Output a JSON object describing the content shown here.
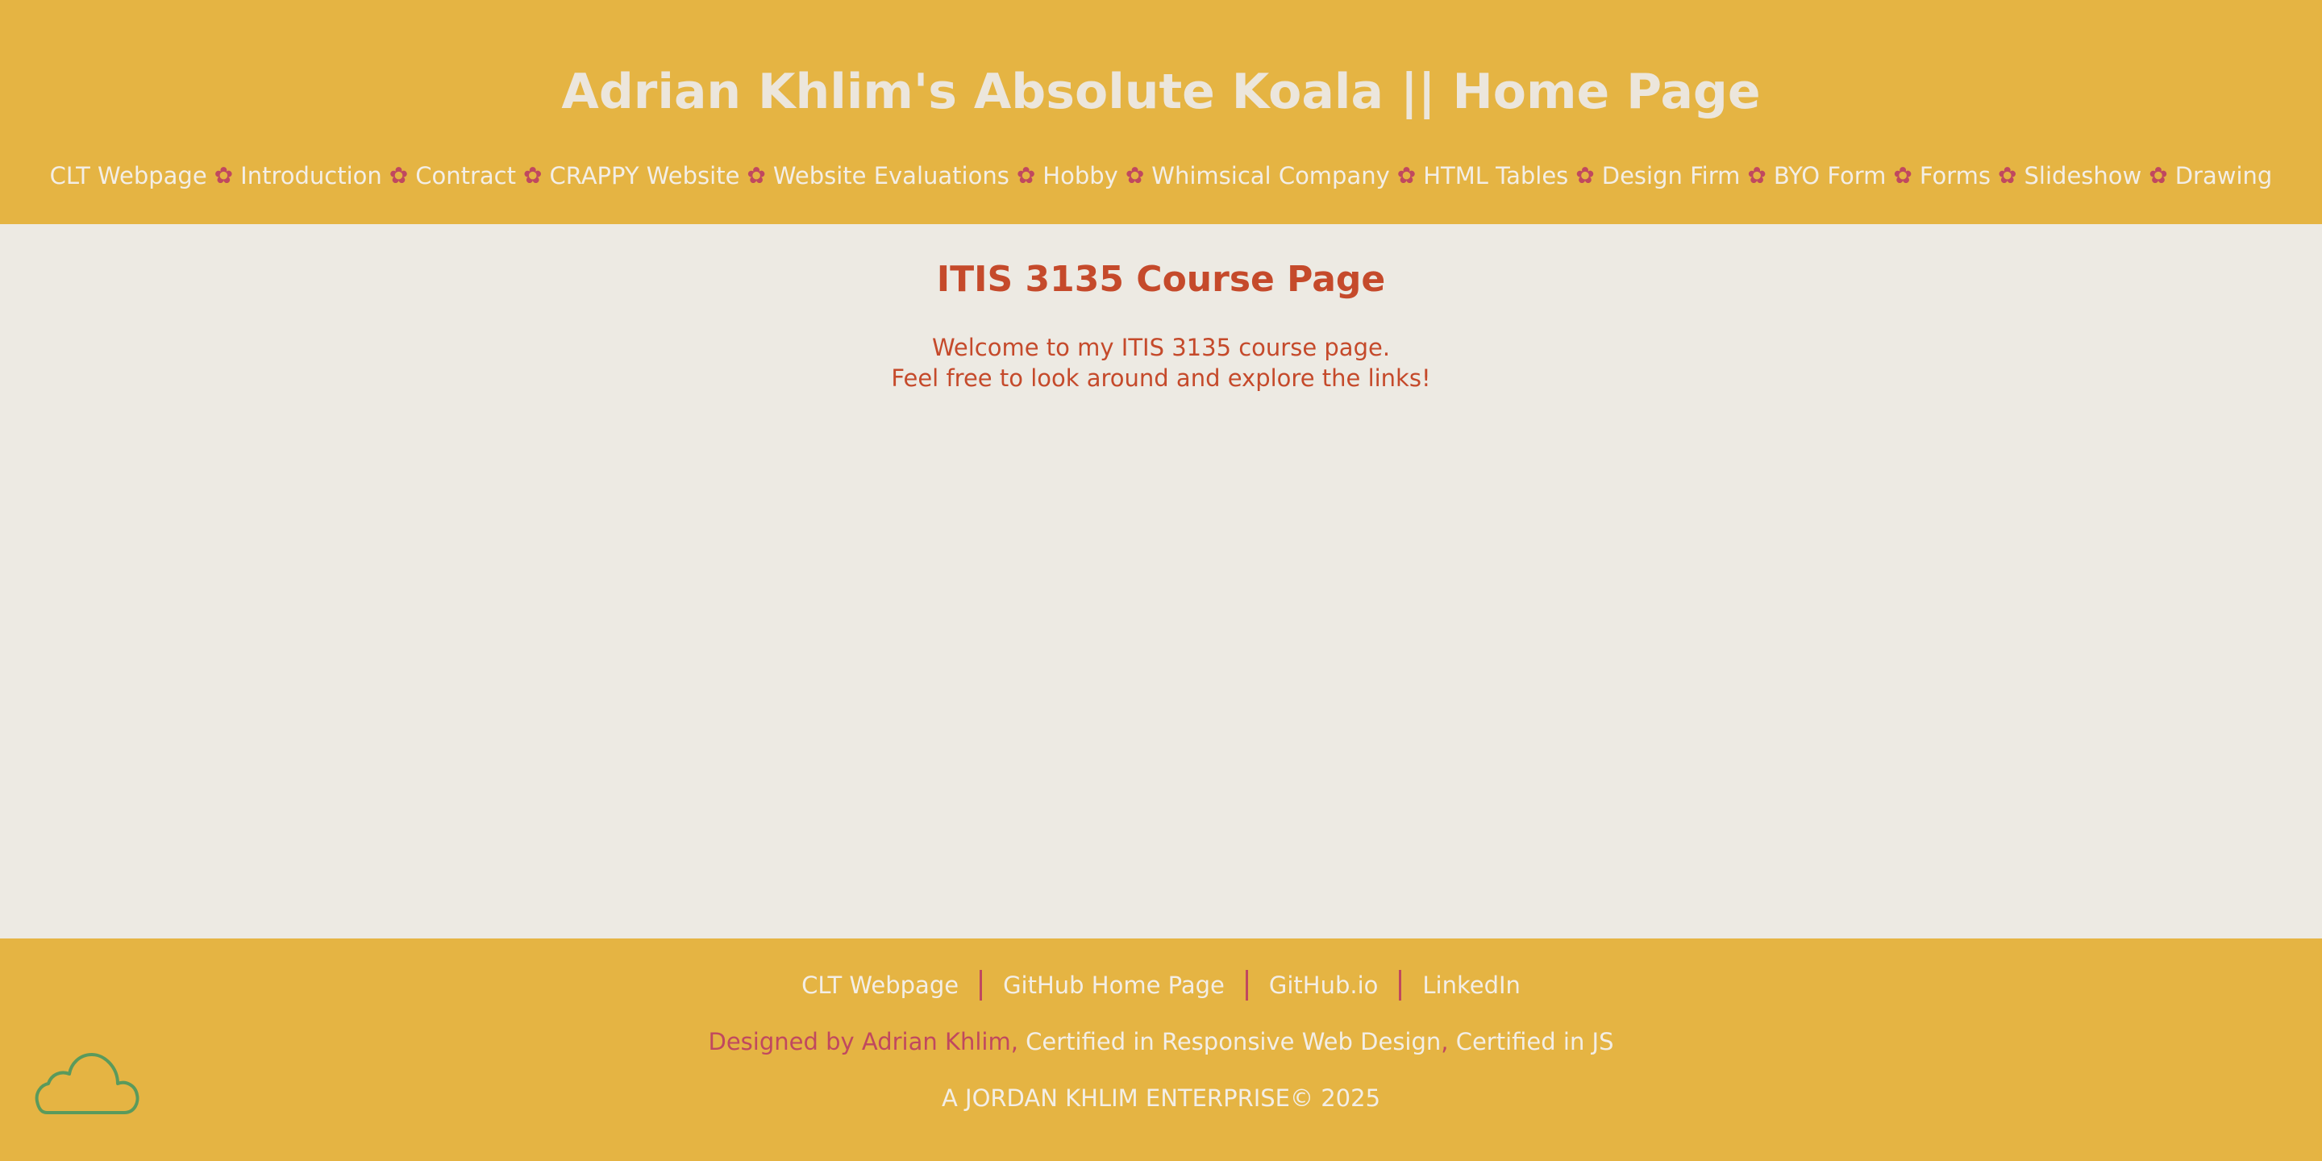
{
  "header": {
    "title": "Adrian Khlim's Absolute Koala || Home Page",
    "nav": [
      "CLT Webpage",
      "Introduction",
      "Contract",
      "CRAPPY Website",
      "Website Evaluations",
      "Hobby",
      "Whimsical Company",
      "HTML Tables",
      "Design Firm",
      "BYO Form",
      "Forms",
      "Slideshow",
      "Drawing"
    ],
    "separator_glyph": "✿"
  },
  "main": {
    "title": "ITIS 3135 Course Page",
    "intro_line1": "Welcome to my ITIS 3135 course page.",
    "intro_line2": "Feel free to look around and explore the links!"
  },
  "footer": {
    "links": [
      "CLT Webpage",
      "GitHub Home Page",
      "GitHub.io",
      "LinkedIn"
    ],
    "designed_by": "Designed by Adrian Khlim",
    "cert_responsive": "Certified in Responsive Web Design",
    "cert_js": "Certified in JS",
    "copyright": "A JORDAN KHLIM ENTERPRISE© 2025",
    "cloud_icon": "cloud-icon"
  },
  "colors": {
    "header_bg": "#e5b443",
    "body_bg": "#edeae3",
    "accent_red": "#c54a2b",
    "separator_pink": "#c0485f",
    "light_text": "#f3eee6",
    "cloud_green": "#5a9a5c"
  }
}
